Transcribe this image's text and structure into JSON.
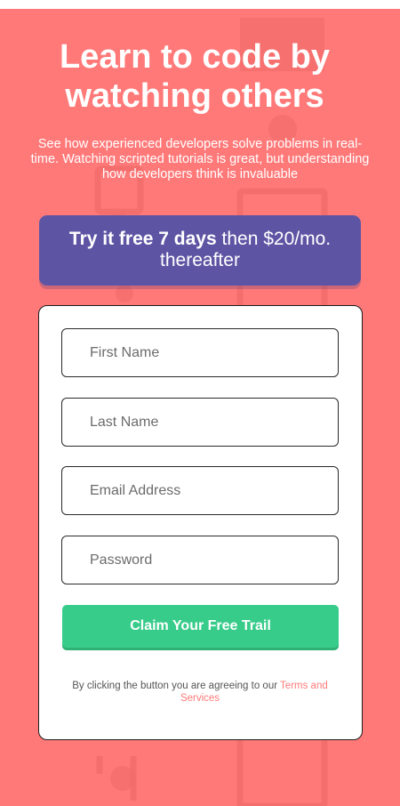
{
  "hero": {
    "title_line1": "Learn to code by",
    "title_line2": "watching others",
    "subtitle": "See how experienced developers solve problems in real-time. Watching scripted tutorials is great, but understanding how developers think is invaluable"
  },
  "trial_banner": {
    "bold": "Try it free 7 days",
    "rest": " then $20/mo. thereafter"
  },
  "form": {
    "first_name_placeholder": "First Name",
    "last_name_placeholder": "Last Name",
    "email_placeholder": "Email Address",
    "password_placeholder": "Password",
    "submit_label": "Claim Your Free Trail",
    "terms_prefix": "By clicking the button you are agreeing to our ",
    "terms_link": "Terms and Services"
  },
  "colors": {
    "background": "#ff7979",
    "banner": "#5d55a4",
    "cta": "#38cc8b",
    "link": "#ff7979"
  }
}
